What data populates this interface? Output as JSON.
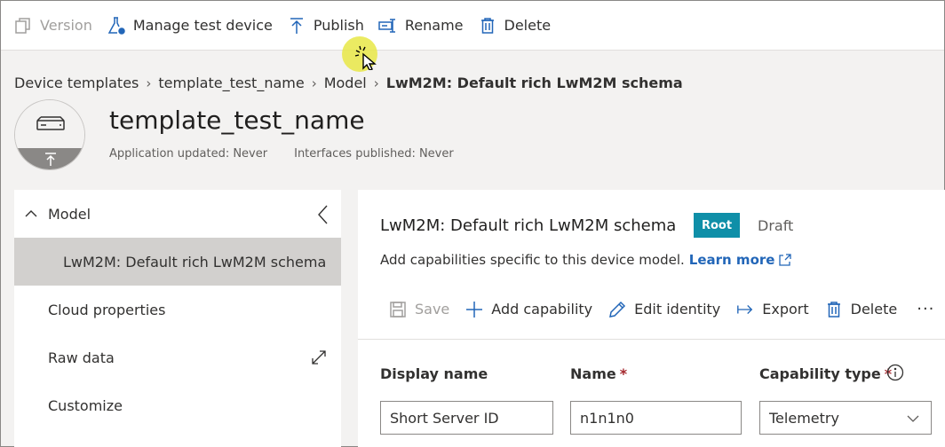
{
  "command_bar": {
    "version": "Version",
    "manage_test_device": "Manage test device",
    "publish": "Publish",
    "rename": "Rename",
    "delete": "Delete"
  },
  "breadcrumb": [
    "Device templates",
    "template_test_name",
    "Model",
    "LwM2M: Default rich LwM2M schema"
  ],
  "header": {
    "title": "template_test_name",
    "app_updated": "Application updated: Never",
    "interfaces_published": "Interfaces published: Never"
  },
  "nav": {
    "model": "Model",
    "schema": "LwM2M: Default rich LwM2M schema",
    "cloud_properties": "Cloud properties",
    "raw_data": "Raw data",
    "customize": "Customize"
  },
  "main": {
    "title": "LwM2M: Default rich LwM2M schema",
    "badge": "Root",
    "status": "Draft",
    "description": "Add capabilities specific to this device model.",
    "learn_more": "Learn more",
    "toolbar": {
      "save": "Save",
      "add_capability": "Add capability",
      "edit_identity": "Edit identity",
      "export": "Export",
      "delete": "Delete",
      "more": "···"
    },
    "form": {
      "display_name_label": "Display name",
      "name_label": "Name",
      "capability_type_label": "Capability type",
      "required_mark": "*",
      "display_name_value": "Short Server ID",
      "name_value": "n1n1n0",
      "capability_type_value": "Telemetry"
    }
  },
  "colors": {
    "accent": "#2266b8",
    "badge": "#0f8fa8",
    "required": "#a4262c",
    "selected_nav": "#d2d0ce",
    "cursor_highlight": "#e8e846"
  }
}
